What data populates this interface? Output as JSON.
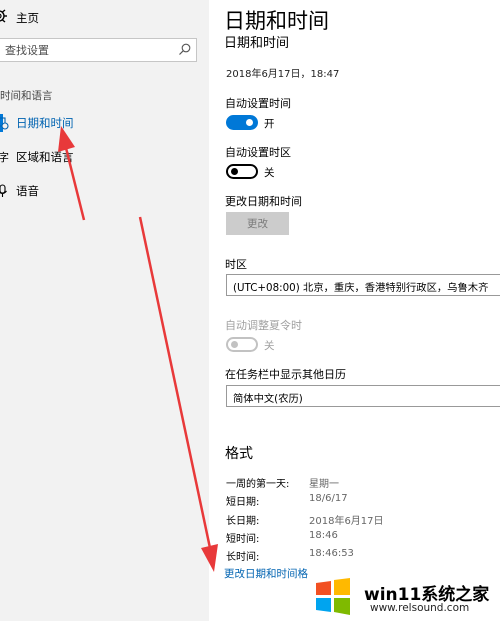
{
  "nav": {
    "home_label": "主页",
    "search_placeholder": "查找设置",
    "section_label": "时间和语言",
    "items": [
      {
        "label": "日期和时间",
        "icon": "calendar-clock-icon",
        "active": true
      },
      {
        "label": "区域和语言",
        "icon": "region-language-icon",
        "active": false
      },
      {
        "label": "语音",
        "icon": "microphone-icon",
        "active": false
      }
    ]
  },
  "content": {
    "title": "日期和时间",
    "subtitle": "日期和时间",
    "current_datetime": "2018年6月17日，18:47",
    "auto_time": {
      "label": "自动设置时间",
      "state": "开",
      "on": true
    },
    "auto_timezone": {
      "label": "自动设置时区",
      "state": "关",
      "on": false
    },
    "change_datetime": {
      "label": "更改日期和时间",
      "button": "更改"
    },
    "timezone": {
      "label": "时区",
      "value": "(UTC+08:00) 北京，重庆，香港特别行政区，乌鲁木齐"
    },
    "dst": {
      "label": "自动调整夏令时",
      "state": "关",
      "disabled": true
    },
    "extra_calendar": {
      "label": "在任务栏中显示其他日历",
      "value": "简体中文(农历)"
    },
    "formats": {
      "title": "格式",
      "rows": [
        {
          "key": "一周的第一天:",
          "value": "星期一"
        },
        {
          "key": "短日期:",
          "value": "18/6/17"
        },
        {
          "key": "长日期:",
          "value": "2018年6月17日"
        },
        {
          "key": "短时间:",
          "value": "18:46"
        },
        {
          "key": "长时间:",
          "value": "18:46:53"
        }
      ],
      "change_link": "更改日期和时间格"
    }
  },
  "watermark": {
    "site": "win11系统之家",
    "url": "www.relsound.com"
  },
  "colors": {
    "accent": "#0078d7",
    "link": "#0063b1",
    "nav_bg": "#f2f2f2",
    "annotation_arrow": "#e8393a"
  }
}
